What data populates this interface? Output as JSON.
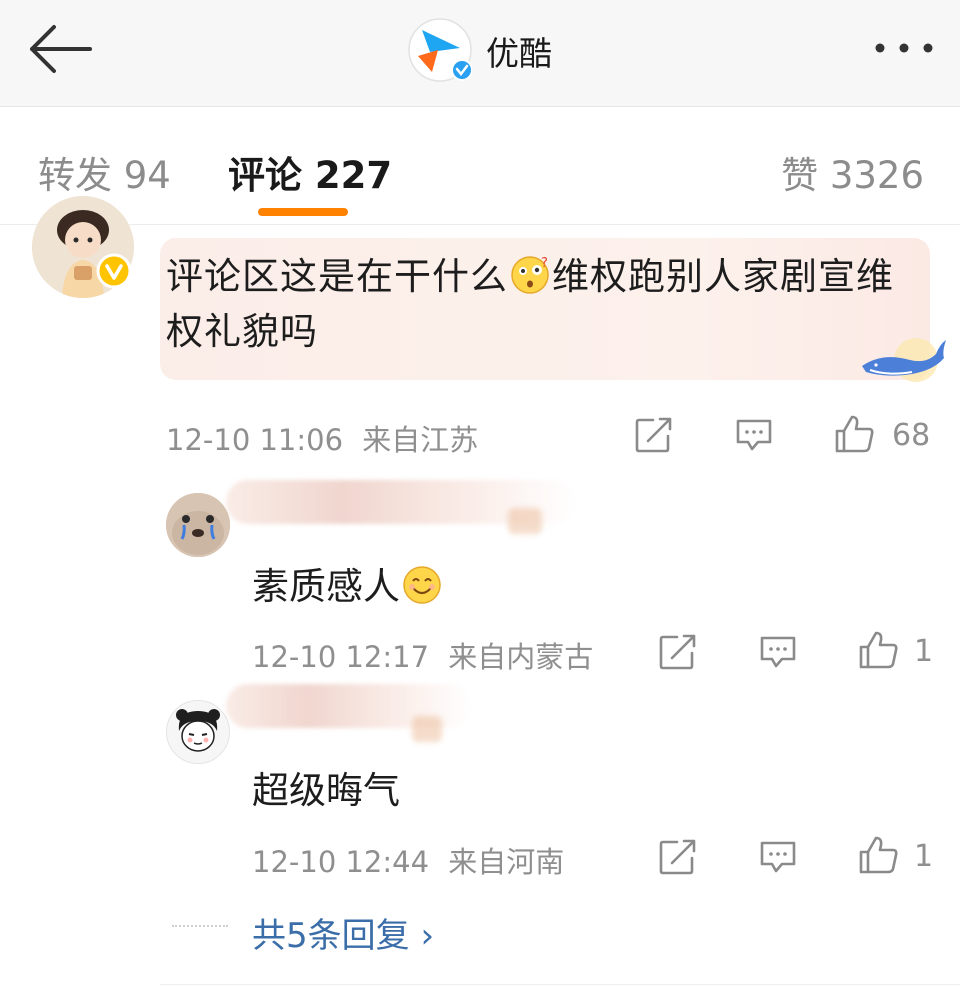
{
  "header": {
    "app_name": "优酷",
    "back_icon": "arrow-left-icon",
    "more_icon": "more-horizontal-icon"
  },
  "tabs": [
    {
      "label": "转发 94"
    },
    {
      "label": "评论 227",
      "active": true
    },
    {
      "label": "赞 3326"
    }
  ],
  "accent_color": "#ff8200",
  "link_color": "#3b6ea8",
  "comment": {
    "text_before_emoji": "评论区这是在干什么",
    "emoji": "confused-face-emoji",
    "text_after_emoji": "维权跑别人家剧宣维权礼貌吗",
    "time": "12-10 11:06",
    "location": "来自江苏",
    "likes": "68"
  },
  "replies": [
    {
      "text": "素质感人",
      "emoji": "smiling-face-emoji",
      "time": "12-10 12:17",
      "location": "来自内蒙古",
      "likes": "1"
    },
    {
      "text": "超级晦气",
      "time": "12-10 12:44",
      "location": "来自河南",
      "likes": "1"
    }
  ],
  "more_replies_label": "共5条回复 ›"
}
